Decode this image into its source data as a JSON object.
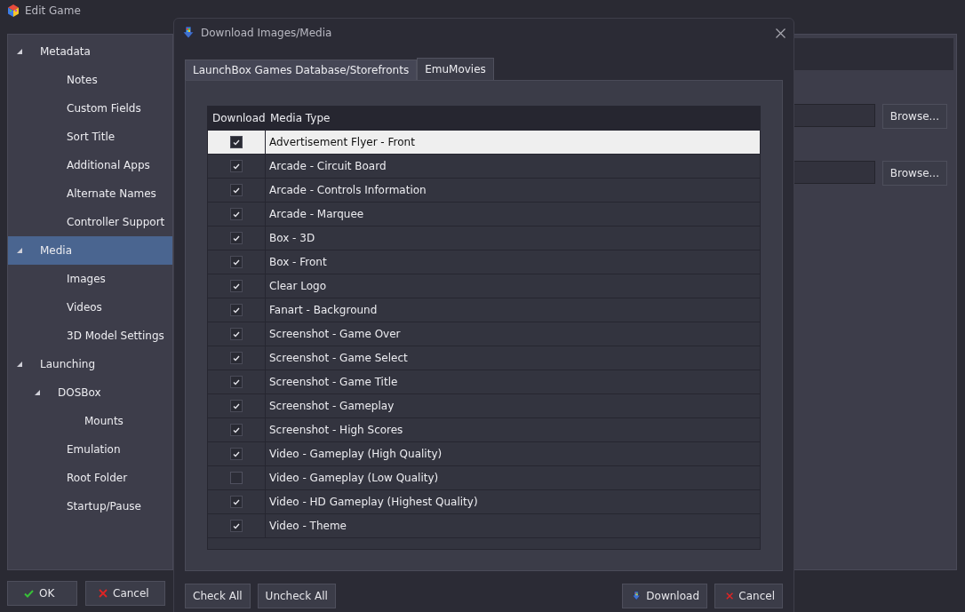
{
  "window": {
    "title": "Edit Game"
  },
  "sidebar": {
    "items": [
      {
        "label": "Metadata",
        "selected": false,
        "expanded": true,
        "children": [
          {
            "label": "Notes",
            "selected": false
          },
          {
            "label": "Custom Fields",
            "selected": false
          },
          {
            "label": "Sort Title",
            "selected": false
          },
          {
            "label": "Additional Apps",
            "selected": false
          },
          {
            "label": "Alternate Names",
            "selected": false
          },
          {
            "label": "Controller Support",
            "selected": false
          }
        ]
      },
      {
        "label": "Media",
        "selected": true,
        "expanded": true,
        "children": [
          {
            "label": "Images",
            "selected": false
          },
          {
            "label": "Videos",
            "selected": false
          },
          {
            "label": "3D Model Settings",
            "selected": false
          }
        ]
      },
      {
        "label": "Launching",
        "selected": false,
        "expanded": true,
        "children": [
          {
            "label": "DOSBox",
            "selected": false,
            "expanded": true,
            "children": [
              {
                "label": "Mounts",
                "selected": false
              }
            ]
          },
          {
            "label": "Emulation",
            "selected": false
          },
          {
            "label": "Root Folder",
            "selected": false
          },
          {
            "label": "Startup/Pause",
            "selected": false
          }
        ]
      }
    ]
  },
  "browse_rows": [
    {
      "button": "Browse..."
    },
    {
      "button": "Browse..."
    }
  ],
  "footer": {
    "ok": "OK",
    "cancel": "Cancel"
  },
  "dialog": {
    "title": "Download Images/Media",
    "tabs": [
      {
        "label": "LaunchBox Games Database/Storefronts",
        "selected": false
      },
      {
        "label": "EmuMovies",
        "selected": true
      }
    ],
    "table": {
      "columns": [
        "Download",
        "Media Type"
      ],
      "rows": [
        {
          "media_type": "Advertisement Flyer - Front",
          "checked": true,
          "selected": true
        },
        {
          "media_type": "Arcade - Circuit Board",
          "checked": true,
          "selected": false
        },
        {
          "media_type": "Arcade - Controls Information",
          "checked": true,
          "selected": false
        },
        {
          "media_type": "Arcade - Marquee",
          "checked": true,
          "selected": false
        },
        {
          "media_type": "Box - 3D",
          "checked": true,
          "selected": false
        },
        {
          "media_type": "Box - Front",
          "checked": true,
          "selected": false
        },
        {
          "media_type": "Clear Logo",
          "checked": true,
          "selected": false
        },
        {
          "media_type": "Fanart - Background",
          "checked": true,
          "selected": false
        },
        {
          "media_type": "Screenshot - Game Over",
          "checked": true,
          "selected": false
        },
        {
          "media_type": "Screenshot - Game Select",
          "checked": true,
          "selected": false
        },
        {
          "media_type": "Screenshot - Game Title",
          "checked": true,
          "selected": false
        },
        {
          "media_type": "Screenshot - Gameplay",
          "checked": true,
          "selected": false
        },
        {
          "media_type": "Screenshot - High Scores",
          "checked": true,
          "selected": false
        },
        {
          "media_type": "Video - Gameplay (High Quality)",
          "checked": true,
          "selected": false
        },
        {
          "media_type": "Video - Gameplay (Low Quality)",
          "checked": false,
          "selected": false
        },
        {
          "media_type": "Video - HD Gameplay (Highest Quality)",
          "checked": true,
          "selected": false
        },
        {
          "media_type": "Video - Theme",
          "checked": true,
          "selected": false
        }
      ]
    },
    "buttons": {
      "check_all": "Check All",
      "uncheck_all": "Uncheck All",
      "download": "Download",
      "cancel": "Cancel"
    }
  }
}
